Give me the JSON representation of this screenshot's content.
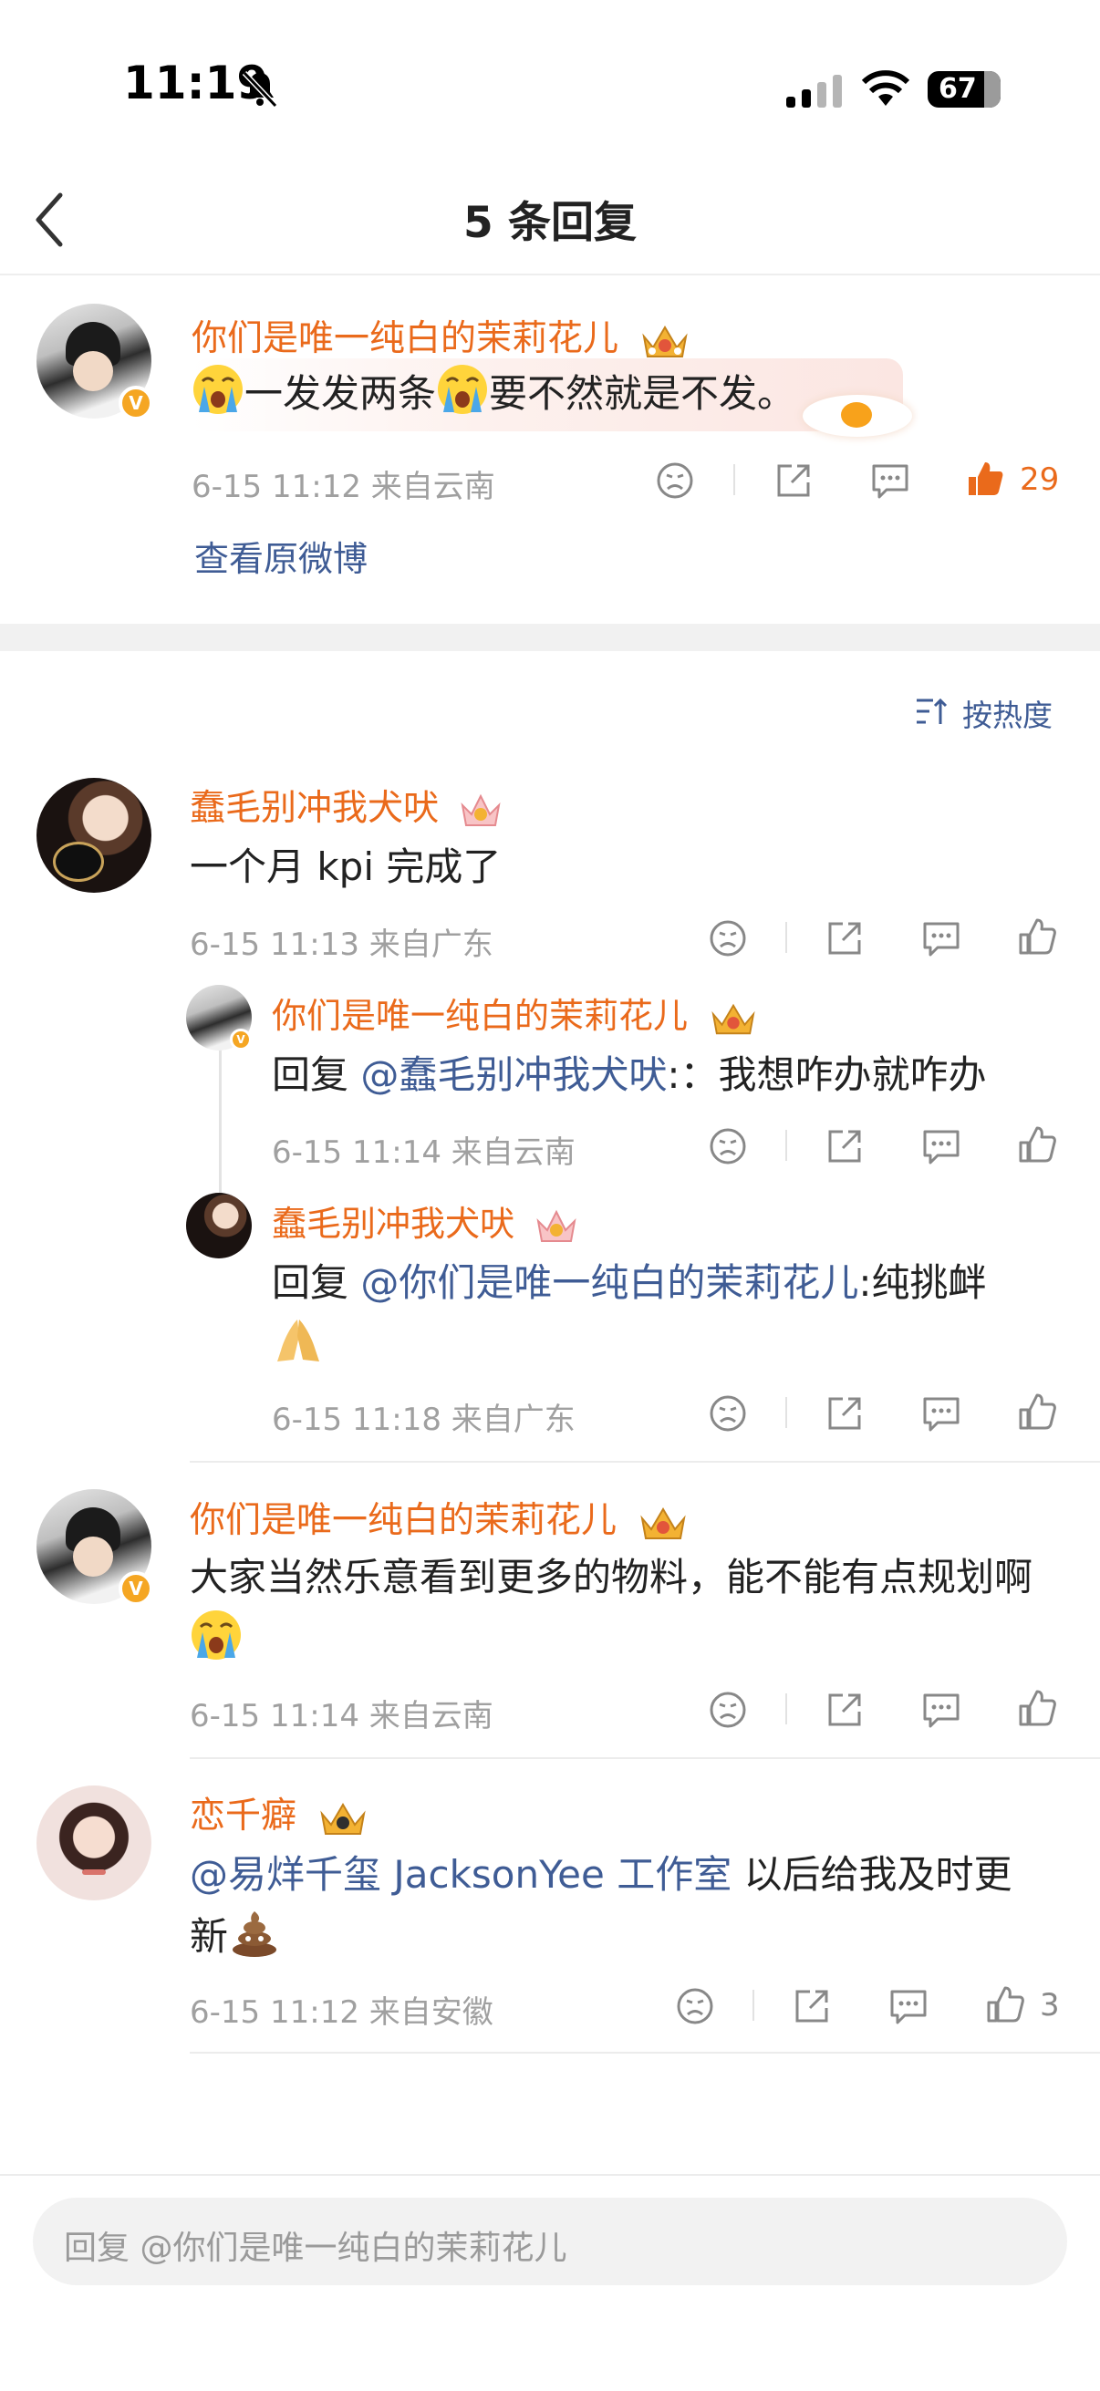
{
  "status_bar": {
    "time": "11:19",
    "battery": "67"
  },
  "header": {
    "title": "5 条回复"
  },
  "root_comment": {
    "user": "你们是唯一纯白的茉莉花儿",
    "text_part1": "一发发两条",
    "text_part2": "要不然就是不发。",
    "meta": "6-15 11:12  来自云南",
    "like_count": "29",
    "view_original": "查看原微博"
  },
  "sort": {
    "label": "按热度"
  },
  "comments": [
    {
      "user": "蠢毛别冲我犬吠",
      "text": "一个月 kpi 完成了",
      "meta": "6-15 11:13  来自广东",
      "replies": [
        {
          "user": "你们是唯一纯白的茉莉花儿",
          "prefix": "回复 ",
          "mention": "@蠢毛别冲我犬吠",
          "text": ":：我想咋办就咋办",
          "meta": "6-15 11:14  来自云南"
        },
        {
          "user": "蠢毛别冲我犬吠",
          "prefix": "回复 ",
          "mention": "@你们是唯一纯白的茉莉花儿",
          "text": ":纯挑衅",
          "meta": "6-15 11:18  来自广东"
        }
      ]
    },
    {
      "user": "你们是唯一纯白的茉莉花儿",
      "text": "大家当然乐意看到更多的物料，能不能有点规划啊",
      "meta": "6-15 11:14  来自云南"
    },
    {
      "user": "恋千癖",
      "mention": "@易烊千玺 JacksonYee 工作室",
      "text": " 以后给我及时更新",
      "meta": "6-15 11:12  来自安徽",
      "like_count": "3"
    }
  ],
  "input": {
    "placeholder": "回复 @你们是唯一纯白的茉莉花儿"
  },
  "colors": {
    "username": "#ea6a1b",
    "link": "#3f5c95",
    "like_active": "#ea6a1b",
    "meta": "#a0a0a0"
  }
}
